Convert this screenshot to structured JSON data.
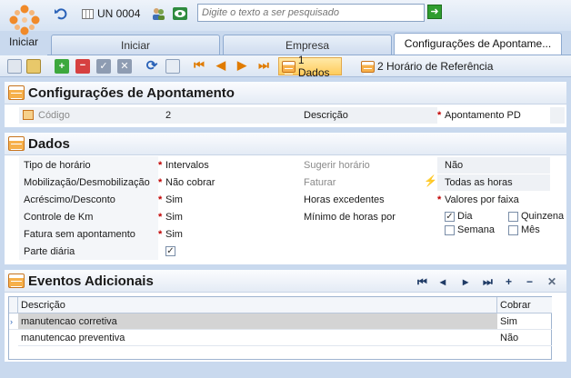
{
  "app": {
    "start_label": "Iniciar",
    "un_code": "UN 0004",
    "search_placeholder": "Digite o texto a ser pesquisado"
  },
  "tabs": [
    {
      "label": "Iniciar"
    },
    {
      "label": "Empresa"
    },
    {
      "label": "Configurações de Apontame..."
    }
  ],
  "toolbar": {
    "dados_label": "1 Dados",
    "horario_label": "2 Horário de Referência"
  },
  "header_panel": {
    "title": "Configurações de Apontamento",
    "codigo_label": "Código",
    "codigo_value": "2",
    "descricao_label": "Descrição",
    "descricao_value": "Apontamento PD"
  },
  "dados": {
    "title": "Dados",
    "tipo_horario_label": "Tipo de horário",
    "tipo_horario_value": "Intervalos",
    "mobilizacao_label": "Mobilização/Desmobilização",
    "mobilizacao_value": "Não cobrar",
    "acrescimo_label": "Acréscimo/Desconto",
    "acrescimo_value": "Sim",
    "controle_km_label": "Controle de Km",
    "controle_km_value": "Sim",
    "fatura_label": "Fatura sem apontamento",
    "fatura_value": "Sim",
    "parte_diaria_label": "Parte diária",
    "parte_diaria_checked": true,
    "sugerir_label": "Sugerir horário",
    "sugerir_value": "Não",
    "faturar_label": "Faturar",
    "faturar_value": "Todas as horas",
    "horas_exc_label": "Horas excedentes",
    "horas_exc_value": "Valores por faixa",
    "minimo_label": "Mínimo de horas por",
    "opt_dia": "Dia",
    "opt_quinzena": "Quinzena",
    "opt_semana": "Semana",
    "opt_mes": "Mês"
  },
  "eventos": {
    "title": "Eventos Adicionais",
    "col_descricao": "Descrição",
    "col_cobrar": "Cobrar",
    "rows": [
      {
        "descricao": "manutencao corretiva",
        "cobrar": "Sim"
      },
      {
        "descricao": "manutencao preventiva",
        "cobrar": "Não"
      }
    ]
  },
  "colors": {
    "accent": "#f6b04b",
    "tab_border": "#8eaad0",
    "required": "#c00000"
  }
}
